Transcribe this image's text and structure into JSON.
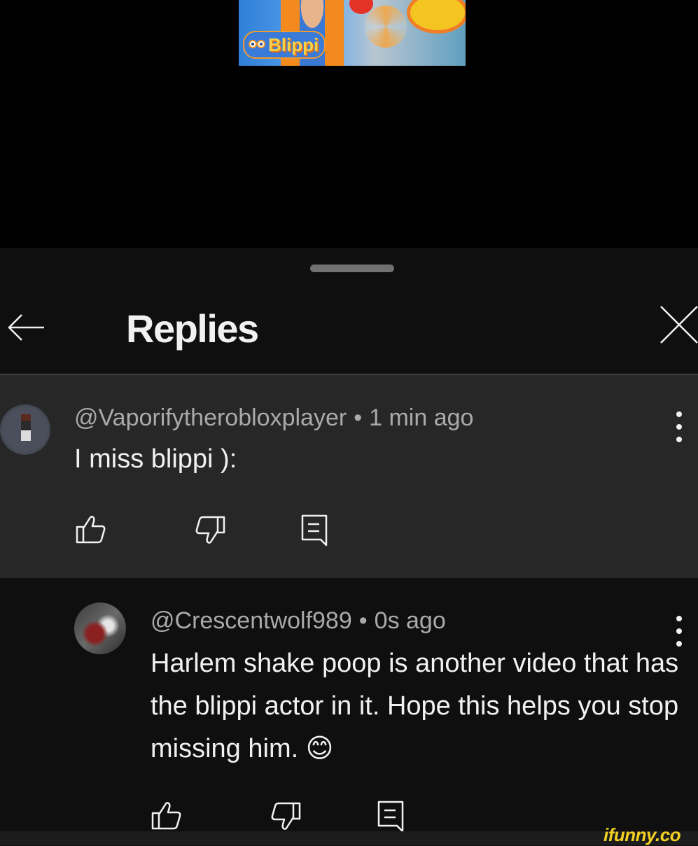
{
  "video": {
    "thumbnail_logo_text": "Blippi"
  },
  "header": {
    "title": "Replies",
    "back_icon": "arrow-left-icon",
    "close_icon": "close-icon"
  },
  "parent_comment": {
    "author": "@Vaporifytherobloxplayer",
    "separator": "•",
    "time": "1 min ago",
    "text": "I miss blippi ):",
    "avatar_icon": "avatar",
    "actions": [
      "thumbs-up-icon",
      "thumbs-down-icon",
      "reply-icon"
    ]
  },
  "reply_comment": {
    "author": "@Crescentwolf989",
    "separator": "•",
    "time": "0s ago",
    "text": "Harlem shake poop is another video that has the blippi actor in it. Hope this helps you stop missing him. 😊",
    "avatar_icon": "avatar",
    "actions": [
      "thumbs-up-icon",
      "thumbs-down-icon",
      "reply-icon"
    ]
  },
  "watermark": "ifunny.co",
  "colors": {
    "background": "#0f0f0f",
    "highlight_row": "#272727",
    "text_primary": "#f1f1f1",
    "text_secondary": "#aaaaaa",
    "watermark": "#f2cf23"
  }
}
